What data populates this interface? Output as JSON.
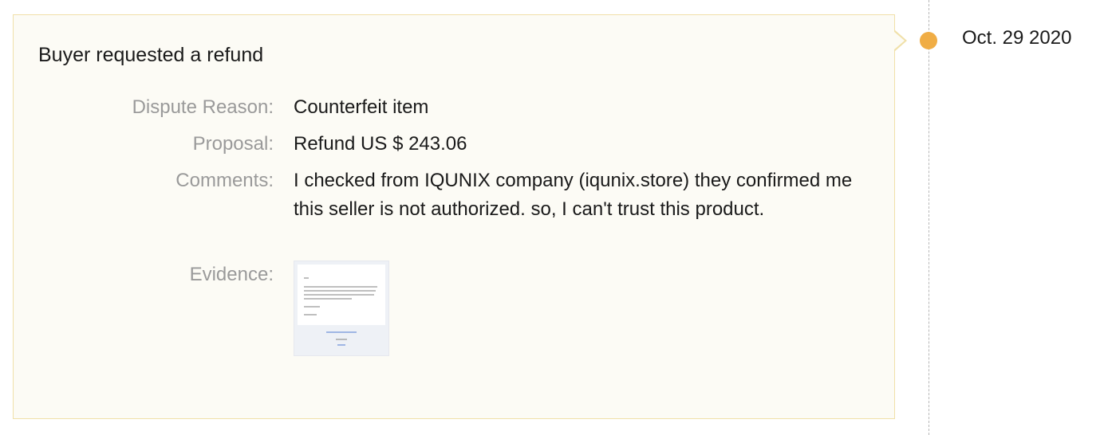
{
  "event": {
    "title": "Buyer requested a refund",
    "date": "Oct. 29 2020",
    "fields": {
      "dispute_reason": {
        "label": "Dispute Reason:",
        "value": "Counterfeit item"
      },
      "proposal": {
        "label": "Proposal:",
        "value": "Refund US $ 243.06"
      },
      "comments": {
        "label": "Comments:",
        "value": "I checked from IQUNIX company (iqunix.store) they confirmed me this seller is not authorized. so, I can't trust this product."
      },
      "evidence": {
        "label": "Evidence:"
      }
    }
  },
  "colors": {
    "card_background": "#fcfbf5",
    "card_border": "#f0e0a8",
    "timeline_dot": "#f0ad45",
    "label_text": "#9a9a9a",
    "value_text": "#1a1a1a"
  },
  "icons": {
    "timeline_marker": "circle-dot-icon",
    "evidence": "image-thumbnail"
  }
}
